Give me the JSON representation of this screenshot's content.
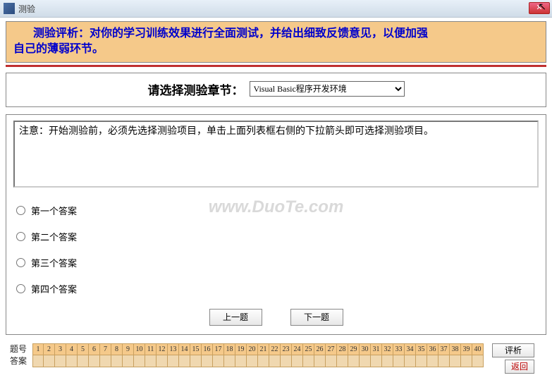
{
  "window": {
    "title": "测验"
  },
  "banner": {
    "prefix": "测验评析：",
    "text_line1": "对你的学习训练效果进行全面测试，并给出细致反馈意见，以便加强",
    "text_line2": "自己的薄弱环节。"
  },
  "chapter": {
    "label": "请选择测验章节：",
    "selected": "Visual Basic程序开发环境"
  },
  "question": {
    "notice": "注意：开始测验前，必须先选择测验项目，单击上面列表框右侧的下拉箭头即可选择测验项目。"
  },
  "answers": {
    "opt1": "第一个答案",
    "opt2": "第二个答案",
    "opt3": "第三个答案",
    "opt4": "第四个答案"
  },
  "nav": {
    "prev": "上一题",
    "next": "下一题"
  },
  "grid": {
    "row_label_num": "题号",
    "row_label_ans": "答案",
    "count": 40
  },
  "buttons": {
    "analyze": "评析",
    "return": "返回"
  },
  "watermark": "www.DuoTe.com"
}
